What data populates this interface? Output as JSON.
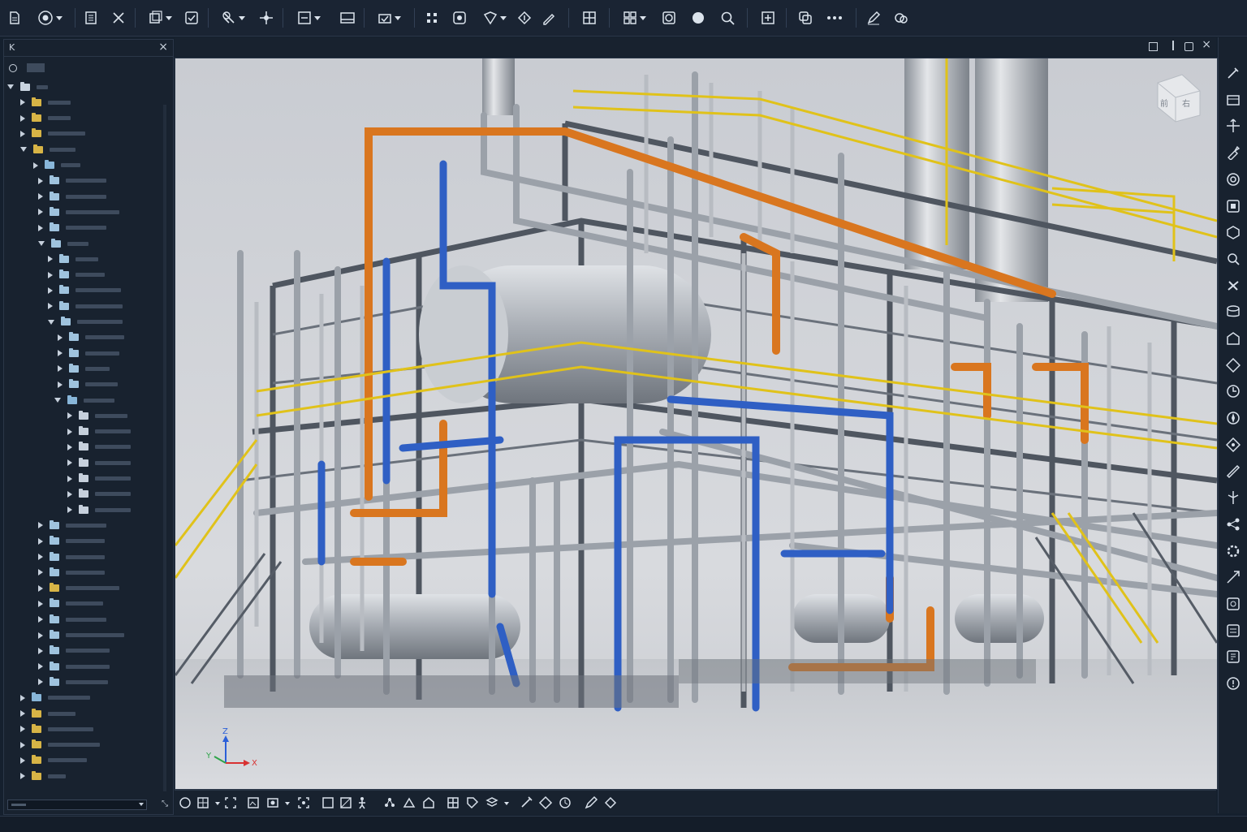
{
  "toolbar": {
    "icons": [
      "new-file-icon",
      "record-icon",
      "document-icon",
      "cut-icon",
      "copy-icon",
      "refresh-icon",
      "measure-icon",
      "snap-icon",
      "clip-icon",
      "layer-icon",
      "check-icon",
      "grid-icon",
      "section-icon",
      "marker-icon",
      "isolate-icon",
      "paint-icon",
      "window-icon",
      "multi-view-icon",
      "orbit-icon",
      "shade-icon",
      "zoom-icon",
      "fit-icon",
      "duplicate-icon",
      "more-icon",
      "edit-icon",
      "link-icon"
    ]
  },
  "panel": {
    "header_glyph": "K",
    "close_glyph": "×"
  },
  "viewport": {
    "viewcube": {
      "left_face": "前",
      "right_face": "右"
    },
    "axes": {
      "x": "X",
      "y": "Y",
      "z": "Z"
    },
    "window_controls": [
      "restore-icon",
      "pin-icon",
      "float-icon",
      "close-icon"
    ]
  },
  "rightbar": {
    "icons": [
      "pin-tool-icon",
      "box-icon",
      "move-icon",
      "pipe-icon",
      "target-icon",
      "library-icon",
      "component-icon",
      "inspect-icon",
      "valve-icon",
      "database-icon",
      "building-icon",
      "diamond-icon",
      "rotate-icon",
      "compass-icon",
      "shape-icon",
      "ruler-icon",
      "split-icon",
      "nodes-icon",
      "settings-icon",
      "extend-icon",
      "panel-icon",
      "report-icon",
      "export-icon",
      "info-icon"
    ]
  },
  "colors": {
    "pipe_orange": "#d9761f",
    "pipe_blue": "#2f5fc4",
    "railing_yellow": "#e0c21a",
    "steel_grey": "#5a626c",
    "vessel_silver": "#a9aeb5"
  }
}
